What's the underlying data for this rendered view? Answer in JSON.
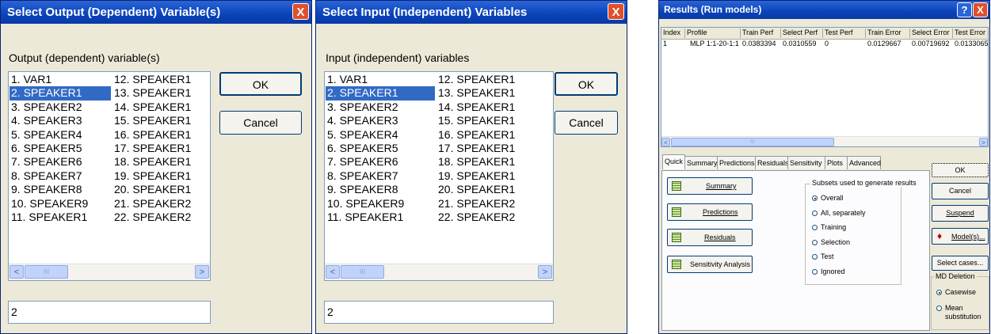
{
  "output_dialog": {
    "title": "Select Output (Dependent) Variable(s)",
    "list_label": "Output (dependent) variable(s)",
    "col1": [
      "1. VAR1",
      "2. SPEAKER1",
      "3. SPEAKER2",
      "4. SPEAKER3",
      "5. SPEAKER4",
      "6. SPEAKER5",
      "7. SPEAKER6",
      "8. SPEAKER7",
      "9. SPEAKER8",
      "10. SPEAKER9",
      "11. SPEAKER1"
    ],
    "col2": [
      "12. SPEAKER1",
      "13. SPEAKER1",
      "14. SPEAKER1",
      "15. SPEAKER1",
      "16. SPEAKER1",
      "17. SPEAKER1",
      "18. SPEAKER1",
      "19. SPEAKER1",
      "20. SPEAKER1",
      "21. SPEAKER2",
      "22. SPEAKER2"
    ],
    "selected_index": 1,
    "ok_label": "OK",
    "cancel_label": "Cancel",
    "selection_value": "2",
    "scroll_thumb_glyph": "III",
    "scroll_left_glyph": "<",
    "scroll_right_glyph": ">",
    "close_glyph": "X"
  },
  "input_dialog": {
    "title": "Select Input (Independent) Variables",
    "list_label": "Input (independent) variables",
    "col1": [
      "1. VAR1",
      "2. SPEAKER1",
      "3. SPEAKER2",
      "4. SPEAKER3",
      "5. SPEAKER4",
      "6. SPEAKER5",
      "7. SPEAKER6",
      "8. SPEAKER7",
      "9. SPEAKER8",
      "10. SPEAKER9",
      "11. SPEAKER1"
    ],
    "col2": [
      "12. SPEAKER1",
      "13. SPEAKER1",
      "14. SPEAKER1",
      "15. SPEAKER1",
      "16. SPEAKER1",
      "17. SPEAKER1",
      "18. SPEAKER1",
      "19. SPEAKER1",
      "20. SPEAKER1",
      "21. SPEAKER2",
      "22. SPEAKER2"
    ],
    "selected_index": 1,
    "ok_label": "OK",
    "cancel_label": "Cancel",
    "selection_value": "2",
    "scroll_thumb_glyph": "III",
    "scroll_left_glyph": "<",
    "scroll_right_glyph": ">",
    "close_glyph": "X"
  },
  "results": {
    "title": "Results (Run models)",
    "help_glyph": "?",
    "close_glyph": "X",
    "columns": [
      "Index",
      "Profile",
      "Train Perf",
      "Select Perf",
      "Test Perf",
      "Train Error",
      "Select Error",
      "Test Error"
    ],
    "rows": [
      [
        "1",
        "MLP 1:1-20-1:1",
        "0.0383394",
        "0.0310559",
        "0",
        "0.0129667",
        "0.00719692",
        "0.0133065"
      ]
    ],
    "scroll_thumb_glyph": "III",
    "scroll_left_glyph": "<",
    "scroll_right_glyph": ">",
    "tabs": [
      "Quick",
      "Summary",
      "Predictions",
      "Residuals",
      "Sensitivity",
      "Plots",
      "Advanced"
    ],
    "active_tab": "Quick",
    "quick_buttons": [
      "Summary",
      "Predictions",
      "Residuals",
      "Sensitivity Analysis"
    ],
    "subsets_label": "Subsets used to generate results",
    "subsets": [
      "Overall",
      "All, separately",
      "Training",
      "Selection",
      "Test",
      "Ignored"
    ],
    "subset_selected": "Overall",
    "side_buttons": {
      "ok": "OK",
      "cancel": "Cancel",
      "suspend": "Suspend",
      "models": "Model(s)...",
      "select_cases": "Select cases..."
    },
    "md_deletion_label": "MD Deletion",
    "md_options": [
      "Casewise",
      "Mean substitution"
    ],
    "md_selected": "Casewise"
  },
  "colors": {
    "titlebar": "#0a43b8",
    "dialog_bg": "#ece9d8",
    "selection": "#316ac5",
    "close": "#e0502a"
  },
  "icons": [
    "close-icon",
    "help-icon",
    "scroll-left-icon",
    "scroll-right-icon",
    "table-grid-icon",
    "models-icon"
  ]
}
